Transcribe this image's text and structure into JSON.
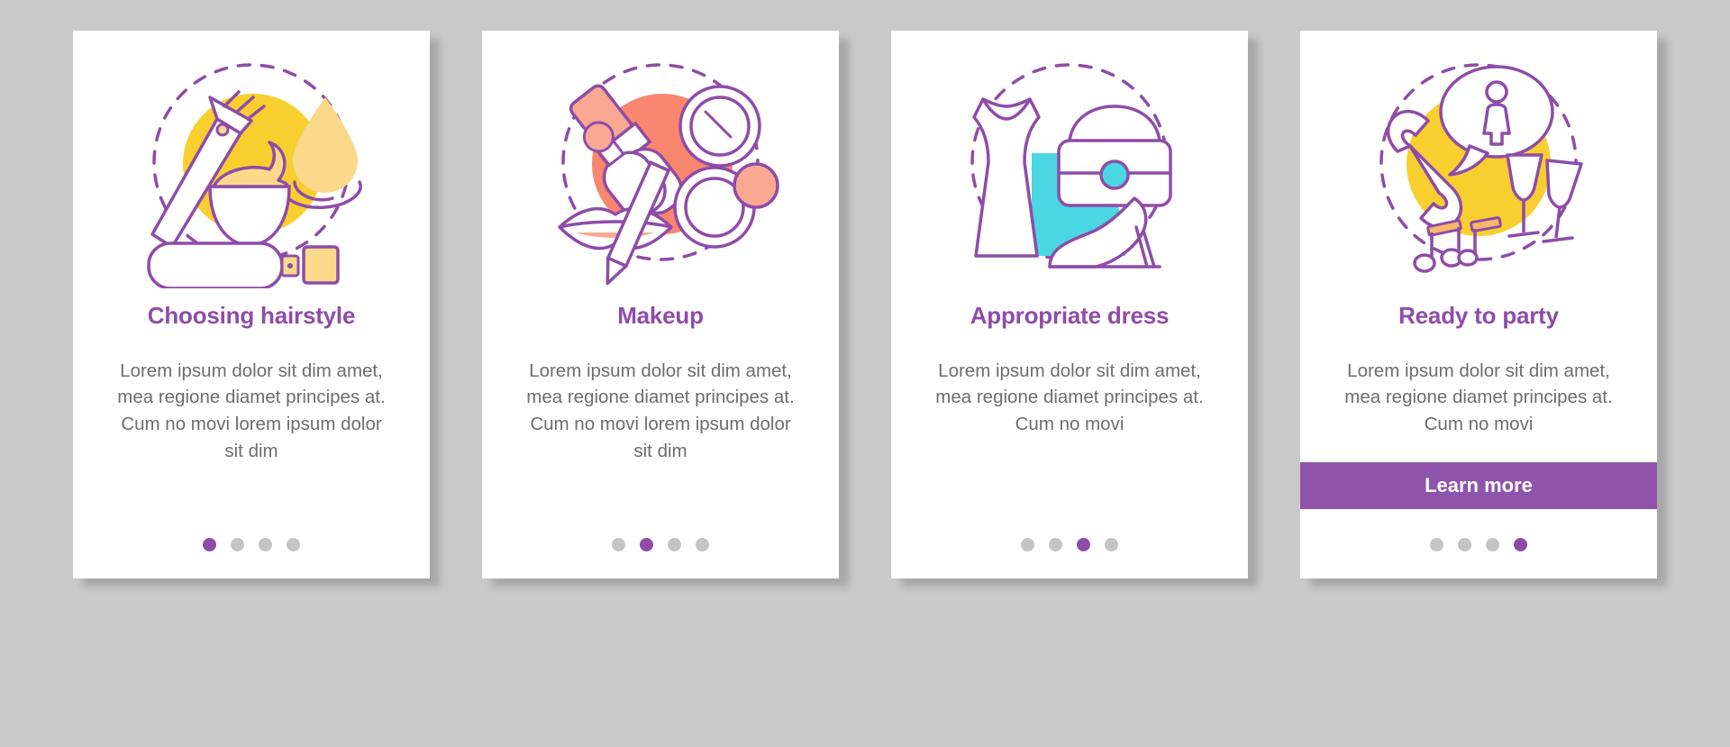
{
  "page": {
    "background_color": "#c9c9c9",
    "accent_purple": "#8e4ca8",
    "body_text_color": "#6d6d6d",
    "card_background": "#ffffff"
  },
  "cards": [
    {
      "illustration_name": "hairstyle-illustration",
      "accent_color": "#f8cf2e",
      "title": "Choosing hairstyle",
      "body": "Lorem ipsum dolor sit dim amet, mea regione diamet principes at. Cum no movi lorem ipsum dolor sit dim",
      "has_button": false,
      "button_label": "",
      "dots": 4,
      "active_dot": 1
    },
    {
      "illustration_name": "makeup-illustration",
      "accent_color": "#f9866e",
      "title": "Makeup",
      "body": "Lorem ipsum dolor sit dim amet, mea regione diamet principes at. Cum no movi lorem ipsum dolor sit dim",
      "has_button": false,
      "button_label": "",
      "dots": 4,
      "active_dot": 2
    },
    {
      "illustration_name": "appropriate-dress-illustration",
      "accent_color": "#4ad7e3",
      "title": "Appropriate dress",
      "body": "Lorem ipsum dolor sit dim amet, mea regione diamet principes at. Cum no movi",
      "has_button": false,
      "button_label": "",
      "dots": 4,
      "active_dot": 3
    },
    {
      "illustration_name": "ready-to-party-illustration",
      "accent_color": "#f8cf2e",
      "title": "Ready to party",
      "body": "Lorem ipsum dolor sit dim amet, mea regione diamet principes at. Cum no movi",
      "has_button": true,
      "button_label": "Learn more",
      "dots": 4,
      "active_dot": 4
    }
  ]
}
